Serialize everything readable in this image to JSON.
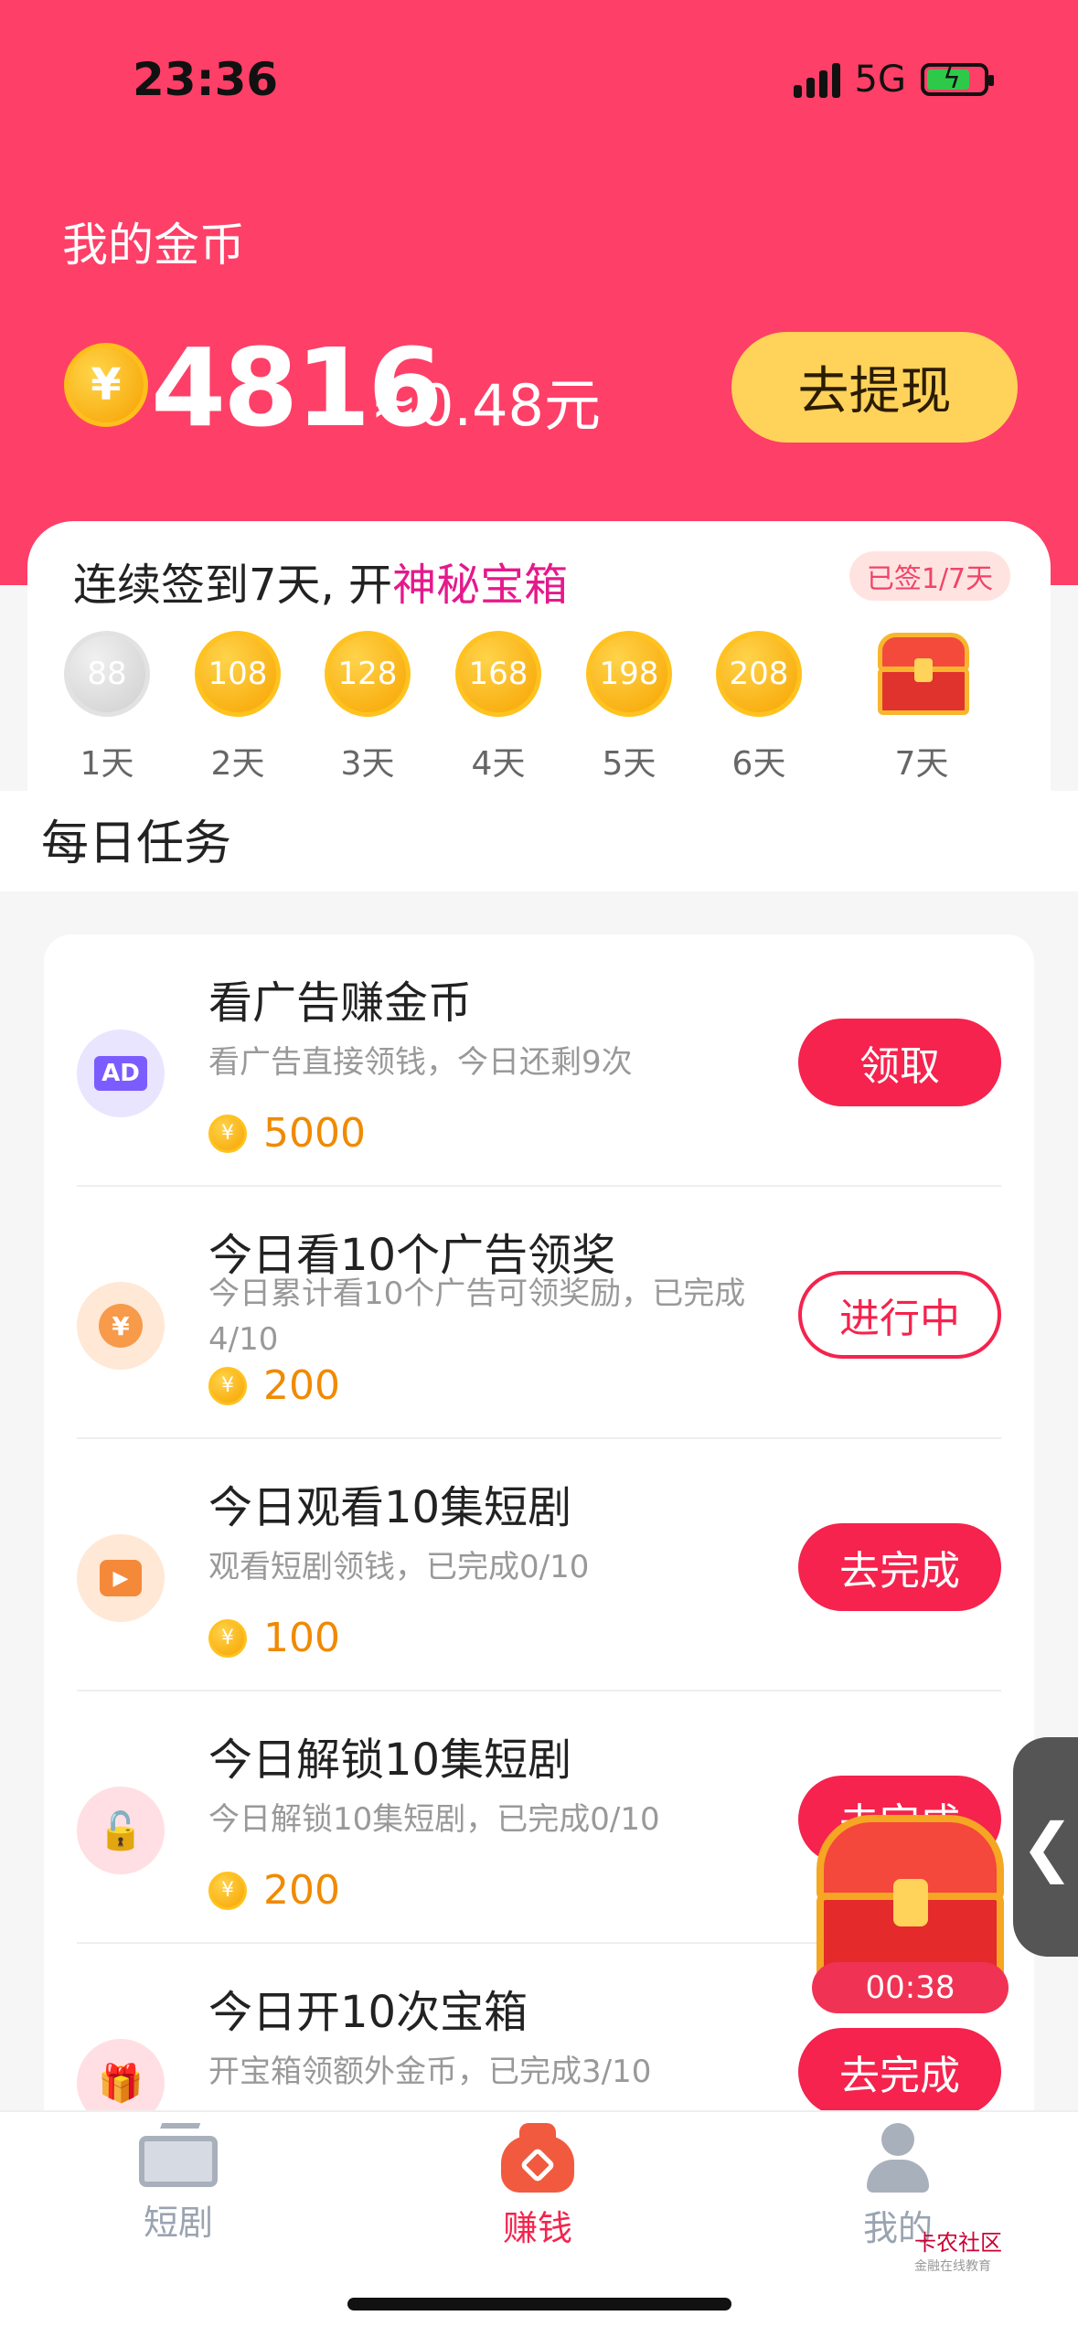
{
  "status": {
    "time": "23:36",
    "network": "5G"
  },
  "header": {
    "title": "我的金币",
    "coin_symbol": "¥",
    "coins": "4816",
    "approx": "≈0.48元",
    "withdraw_label": "去提现"
  },
  "signin": {
    "title_prefix": "连续签到7天, 开",
    "title_highlight": "神秘宝箱",
    "badge": "已签1/7天",
    "days": [
      {
        "value": "88",
        "label": "1天"
      },
      {
        "value": "108",
        "label": "2天"
      },
      {
        "value": "128",
        "label": "3天"
      },
      {
        "value": "168",
        "label": "4天"
      },
      {
        "value": "198",
        "label": "5天"
      },
      {
        "value": "208",
        "label": "6天"
      }
    ],
    "chest_label": "7天"
  },
  "daily": {
    "title": "每日任务"
  },
  "tasks": [
    {
      "icon": "AD",
      "name": "看广告赚金币",
      "desc": "看广告直接领钱，今日还剩9次",
      "reward": "5000",
      "button": "领取"
    },
    {
      "icon": "¥",
      "name": "今日看10个广告领奖",
      "desc": "今日累计看10个广告可领奖励，已完成4/10",
      "reward": "200",
      "button": "进行中"
    },
    {
      "icon": "▶",
      "name": "今日观看10集短剧",
      "desc": "观看短剧领钱，已完成0/10",
      "reward": "100",
      "button": "去完成"
    },
    {
      "icon": "🔓",
      "name": "今日解锁10集短剧",
      "desc": "今日解锁10集短剧，已完成0/10",
      "reward": "200",
      "button": "去完成"
    },
    {
      "icon": "🎁",
      "name": "今日开10次宝箱",
      "desc": "开宝箱领额外金币，已完成3/10",
      "reward": "",
      "button": "去完成"
    }
  ],
  "float": {
    "timer": "00:38",
    "side_arrow": "❮"
  },
  "tabbar": {
    "tab1": "短剧",
    "tab2": "赚钱",
    "tab3": "我的"
  },
  "watermark": {
    "title": "卡农社区",
    "sub": "金融在线教育"
  },
  "colors": {
    "brand": "#fe3f67",
    "button": "#f5234d",
    "coin": "#f7a400",
    "withdraw": "#ffd25a"
  }
}
